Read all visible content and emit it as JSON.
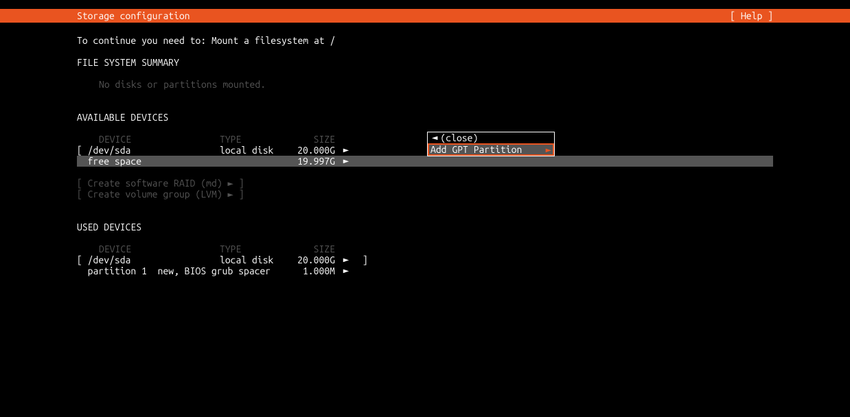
{
  "header": {
    "title": "Storage configuration",
    "help": "[ Help ]"
  },
  "hint": "To continue you need to: Mount a filesystem at /",
  "fs_summary": {
    "heading": "FILE SYSTEM SUMMARY",
    "empty": "No disks or partitions mounted."
  },
  "available": {
    "heading": "AVAILABLE DEVICES",
    "columns": {
      "device": "DEVICE",
      "type": "TYPE",
      "size": "SIZE"
    },
    "rows": [
      {
        "device": "[ /dev/sda",
        "type": "local disk",
        "size": "20.000G",
        "expand": "►",
        "trail": ""
      },
      {
        "device": "  free space",
        "type": "",
        "size": "19.997G",
        "expand": "►",
        "selected": true
      }
    ],
    "actions": [
      "[ Create software RAID (md) ► ]",
      "[ Create volume group (LVM) ► ]"
    ]
  },
  "used": {
    "heading": "USED DEVICES",
    "columns": {
      "device": "DEVICE",
      "type": "TYPE",
      "size": "SIZE"
    },
    "rows": [
      {
        "device": "[ /dev/sda",
        "type": "local disk",
        "size": "20.000G",
        "expand": "►",
        "trail": " ]"
      },
      {
        "device": "  partition 1  new, BIOS grub spacer",
        "type": "",
        "size": "1.000M",
        "expand": "►",
        "trail": ""
      }
    ]
  },
  "menu": {
    "close": {
      "arrow": "◄",
      "label": "(close)"
    },
    "item": {
      "label": "Add GPT Partition",
      "arrow": "►"
    }
  },
  "glyphs": {
    "tri_right": "►",
    "tri_left": "◄"
  }
}
